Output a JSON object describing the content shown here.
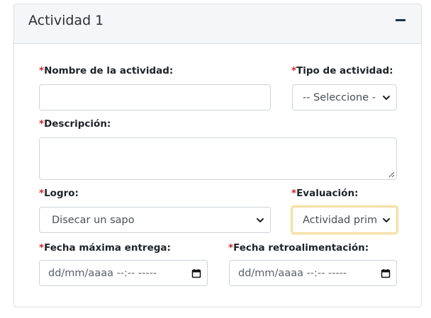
{
  "card": {
    "title": "Actividad 1",
    "collapse_icon": "minus-icon"
  },
  "fields": {
    "required_mark": "*",
    "nombre": {
      "label": "Nombre de la actividad:",
      "value": ""
    },
    "tipo": {
      "label": "Tipo de actividad:",
      "selected": "-- Seleccione -"
    },
    "descripcion": {
      "label": "Descripción:",
      "value": ""
    },
    "logro": {
      "label": "Logro:",
      "selected": "Disecar un sapo"
    },
    "evaluacion": {
      "label": "Evaluación:",
      "selected": "Actividad prim"
    },
    "fecha_entrega": {
      "label": "Fecha máxima entrega:",
      "placeholder": "dd/mm/aaaa --:-- -----"
    },
    "fecha_retro": {
      "label": "Fecha retroalimentación:",
      "placeholder": "dd/mm/aaaa --:-- -----"
    }
  },
  "colors": {
    "required": "#c62828",
    "focus_border": "#f2dc9c",
    "header_bg": "#f5f6f8"
  }
}
